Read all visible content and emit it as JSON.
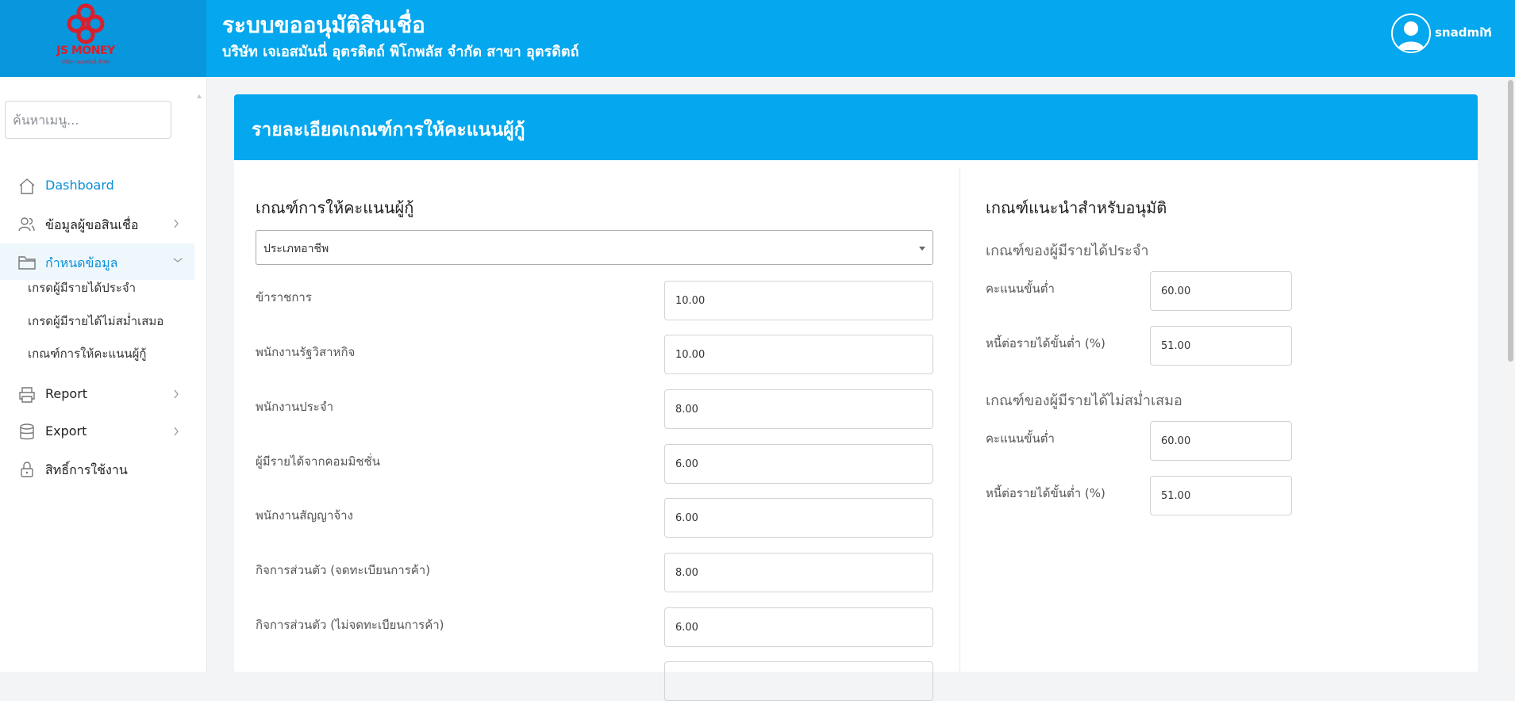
{
  "header": {
    "logo_text": "JS MONEY",
    "logo_sub": "บริษัท เจเอสมันนี่ จำกัด",
    "title": "ระบบขออนุมัติสินเชื่อ",
    "subtitle": "บริษัท เจเอสมันนี่ อุตรดิตถ์ พิโกพลัส จำกัด สาขา อุตรดิตถ์",
    "username": "snadmin"
  },
  "sidebar": {
    "search_placeholder": "ค้นหาเมนู...",
    "items": [
      {
        "label": "Dashboard",
        "icon": "home-icon"
      },
      {
        "label": "ข้อมูลผู้ขอสินเชื่อ",
        "icon": "users-icon"
      },
      {
        "label": "กำหนดข้อมูล",
        "icon": "folder-icon"
      },
      {
        "label": "Report",
        "icon": "printer-icon"
      },
      {
        "label": "Export",
        "icon": "database-icon"
      },
      {
        "label": "สิทธิ์การใช้งาน",
        "icon": "lock-icon"
      }
    ],
    "sub_items": [
      "เกรดผู้มีรายได้ประจำ",
      "เกรดผู้มีรายได้ไม่สม่ำเสมอ",
      "เกณฑ์การให้คะแนนผู้กู้"
    ]
  },
  "card": {
    "title": "รายละเอียดเกณฑ์การให้คะแนนผู้กู้"
  },
  "left": {
    "section_title": "เกณฑ์การให้คะแนนผู้กู้",
    "select_value": "ประเภทอาชีพ",
    "rows": [
      {
        "label": "ข้าราชการ",
        "value": "10.00"
      },
      {
        "label": "พนักงานรัฐวิสาหกิจ",
        "value": "10.00"
      },
      {
        "label": "พนักงานประจำ",
        "value": "8.00"
      },
      {
        "label": "ผู้มีรายได้จากคอมมิชชั่น",
        "value": "6.00"
      },
      {
        "label": "พนักงานสัญญาจ้าง",
        "value": "6.00"
      },
      {
        "label": "กิจการส่วนตัว (จดทะเบียนการค้า)",
        "value": "8.00"
      },
      {
        "label": "กิจการส่วนตัว (ไม่จดทะเบียนการค้า)",
        "value": "6.00"
      }
    ]
  },
  "right": {
    "section_title": "เกณฑ์แนะนำสำหรับอนุมัติ",
    "groups": [
      {
        "title": "เกณฑ์ของผู้มีรายได้ประจำ",
        "min_score_label": "คะแนนขั้นต่ำ",
        "min_score": "60.00",
        "dti_label": "หนี้ต่อรายได้ขั้นต่ำ (%)",
        "dti": "51.00"
      },
      {
        "title": "เกณฑ์ของผู้มีรายได้ไม่สม่ำเสมอ",
        "min_score_label": "คะแนนขั้นต่ำ",
        "min_score": "60.00",
        "dti_label": "หนี้ต่อรายได้ขั้นต่ำ (%)",
        "dti": "51.00"
      }
    ]
  },
  "colors": {
    "primary": "#05a7ee",
    "logo_bg": "#0896dc",
    "brand_red": "#d8202c"
  }
}
